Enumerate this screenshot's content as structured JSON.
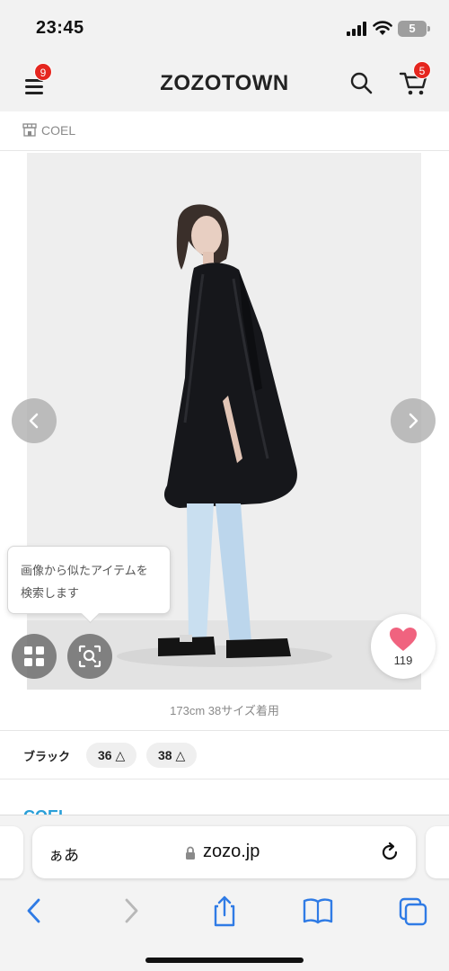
{
  "status_bar": {
    "time": "23:45",
    "battery": "5"
  },
  "header": {
    "logo": "ZOZOTOWN",
    "menu_badge": "9",
    "cart_badge": "5",
    "icons": [
      "menu-icon",
      "search-icon",
      "cart-icon"
    ]
  },
  "brand": {
    "name": "COEL",
    "icon": "shop-icon"
  },
  "product": {
    "image_search_tooltip": "画像から似たアイテムを検索します",
    "favorite_count": "119",
    "model_caption": "173cm 38サイズ着用"
  },
  "variants": {
    "color": "ブラック",
    "sizes": [
      {
        "label": "36",
        "stock_mark": "△"
      },
      {
        "label": "38",
        "stock_mark": "△"
      }
    ]
  },
  "brand_link": "COEL",
  "browser": {
    "aa_label": "ぁあ",
    "url": "zozo.jp"
  },
  "colors": {
    "badge": "#e5261f",
    "favorite_heart": "#f0637f",
    "link": "#2a9fd8",
    "safari_blue": "#2f7be5"
  }
}
